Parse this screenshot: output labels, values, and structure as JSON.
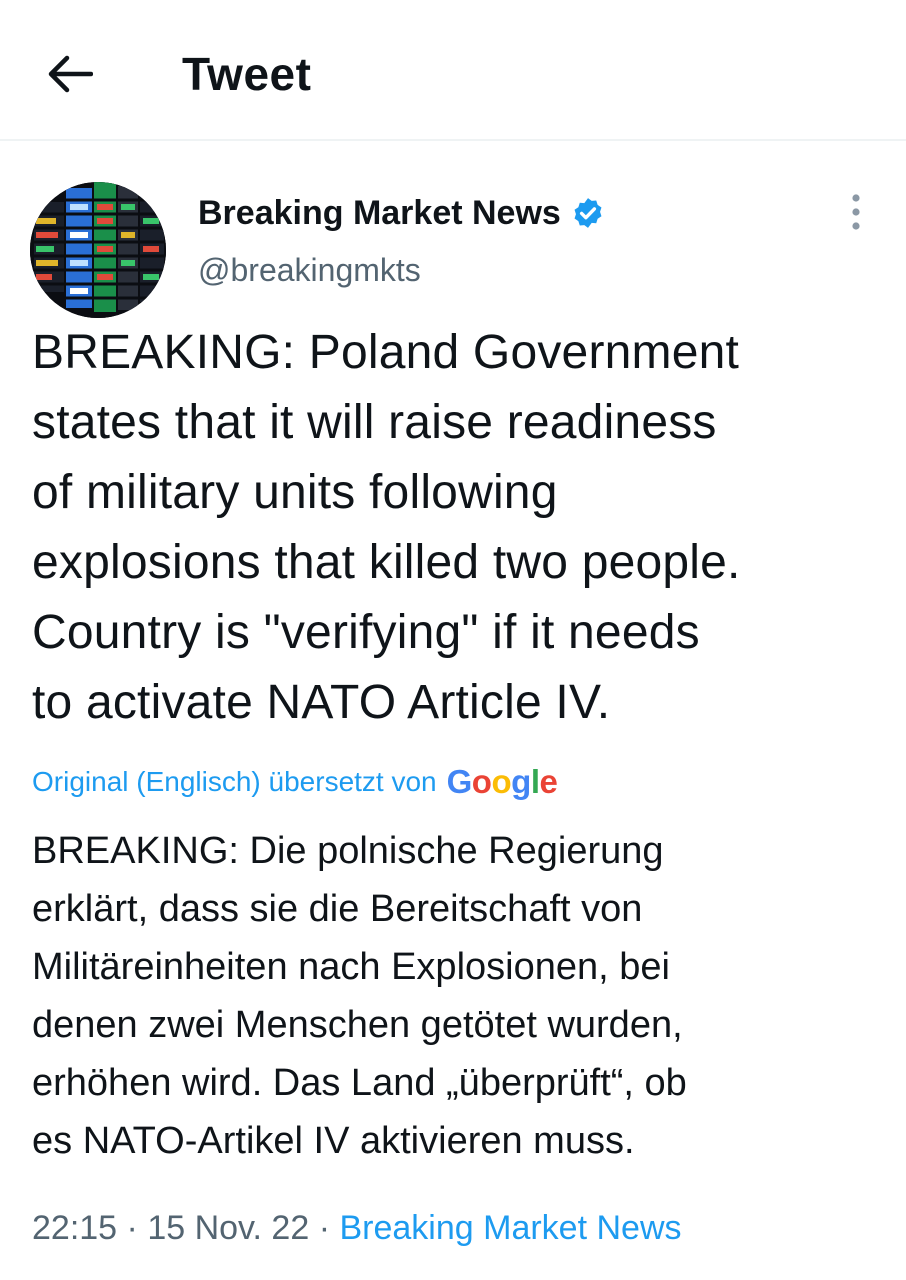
{
  "header": {
    "title": "Tweet",
    "back_icon": "arrow-left-icon"
  },
  "tweet": {
    "author_name": "Breaking Market News",
    "author_handle": "@breakingmkts",
    "verified": true,
    "text": "BREAKING: Poland Government\nstates that it will raise readiness\nof military units following\nexplosions that killed two people.\nCountry is \"verifying\" if it needs\nto activate NATO Article IV.",
    "translation_note": "Original (Englisch) übersetzt von",
    "translation_provider": "Google",
    "translated_text": "BREAKING: Die polnische Regierung\nerklärt, dass sie die Bereitschaft von\nMilitäreinheiten nach Explosionen, bei\ndenen zwei Menschen getötet wurden,\nerhöhen wird. Das Land „überprüft“, ob\nes NATO-Artikel IV aktivieren muss.",
    "time": "22:15",
    "separator": "·",
    "date": "15 Nov. 22",
    "source": "Breaking Market News"
  },
  "colors": {
    "link_blue": "#1d9bf0",
    "secondary_text": "#536471",
    "primary_text": "#0f1419",
    "divider": "#eff3f4"
  }
}
